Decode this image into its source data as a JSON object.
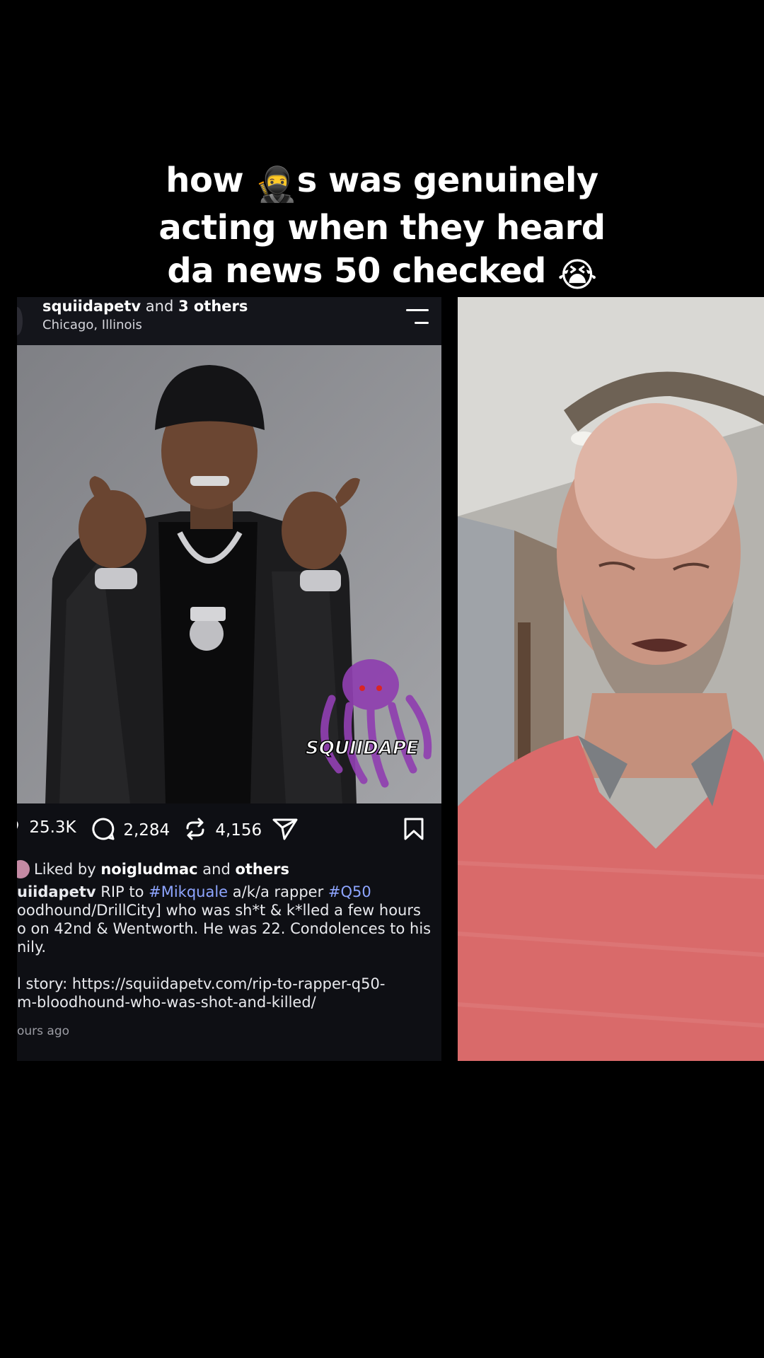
{
  "caption": {
    "line1_pre": "how ",
    "line1_emoji": "🥷",
    "line1_post": "s was genuinely",
    "line2": "acting when they heard",
    "line3": "da news 50 checked ",
    "line3_emoji": "😭"
  },
  "post": {
    "username": "squiidapetv",
    "and_text": " and ",
    "others": "3 others",
    "location": "Chicago, Illinois",
    "watermark": "SQUIIDAPE",
    "stats": {
      "likes": "25.3K",
      "comments": "2,284",
      "reposts": "4,156"
    },
    "liked_by_prefix": "Liked by ",
    "liked_by_user": "noigludmac",
    "liked_by_mid": " and ",
    "liked_by_others": "others",
    "caption_user": "uiidapetv",
    "caption_l1_a": " RIP to ",
    "caption_tag1": "#Mikquale",
    "caption_l1_b": " a/k/a rapper ",
    "caption_tag2": "#Q50",
    "caption_l2": "oodhound/DrillCity] who was sh*t & k*lled a few hours",
    "caption_l3": "o on 42nd & Wentworth. He was 22. Condolences to his",
    "caption_l4": "nily.",
    "caption_l6": "l story: https://squiidapetv.com/rip-to-rapper-q50-",
    "caption_l7": "m-bloodhound-who-was-shot-and-killed/",
    "time": "ours ago"
  },
  "colors": {
    "background": "#000000",
    "post_bg": "#0e0f14",
    "hashtag": "#8ea5ff",
    "shirt": "#d96a6a"
  },
  "icons": [
    "heart-icon",
    "comment-icon",
    "repost-icon",
    "share-icon",
    "bookmark-icon",
    "menu-icon"
  ]
}
